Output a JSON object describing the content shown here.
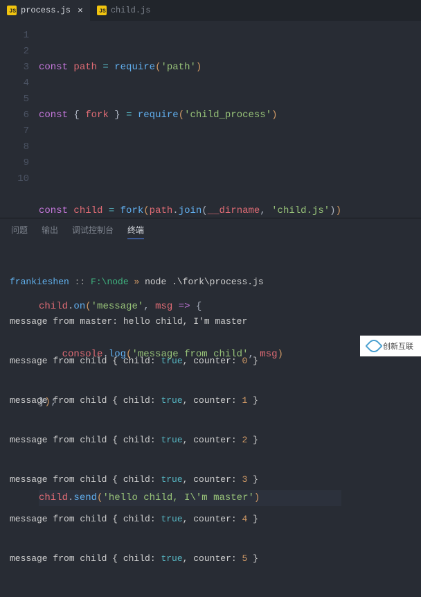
{
  "tabs": [
    {
      "icon": "JS",
      "name": "process.js",
      "active": true,
      "closable": true
    },
    {
      "icon": "JS",
      "name": "child.js",
      "active": false,
      "closable": false
    }
  ],
  "gutter": [
    "1",
    "2",
    "3",
    "4",
    "5",
    "6",
    "7",
    "8",
    "9",
    "10"
  ],
  "code": {
    "l1": {
      "kw": "const",
      "var": "path",
      "eq": " = ",
      "fn": "require",
      "po": "(",
      "str": "'path'",
      "pc": ")"
    },
    "l2": {
      "kw": "const",
      "ob": " { ",
      "var": "fork",
      "cb": " } ",
      "eq": "= ",
      "fn": "require",
      "po": "(",
      "str": "'child_process'",
      "pc": ")"
    },
    "l4": {
      "kw": "const",
      "var": "child",
      "eq": " = ",
      "fn": "fork",
      "po": "(",
      "obj": "path",
      "dot": ".",
      "m": "join",
      "po2": "(",
      "dn": "__dirname",
      "cm": ", ",
      "str": "'child.js'",
      "pc2": ")",
      "pc": ")"
    },
    "l6": {
      "obj": "child",
      "dot": ".",
      "fn": "on",
      "po": "(",
      "str": "'message'",
      "cm": ", ",
      "arg": "msg",
      "arw": " => ",
      "br": "{"
    },
    "l7": {
      "ind": "    ",
      "obj": "console",
      "dot": ".",
      "fn": "log",
      "po": "(",
      "str": "'message from child'",
      "cm": ", ",
      "var": "msg",
      "pc": ")"
    },
    "l8": {
      "br": "}",
      "pc": ")",
      "sc": ";"
    },
    "l10": {
      "obj": "child",
      "dot": ".",
      "fn": "send",
      "po": "(",
      "str": "'hello child, I\\'m master'",
      "pc": ")"
    }
  },
  "panel_tabs": {
    "problems": "问题",
    "output": "输出",
    "debug": "调试控制台",
    "terminal": "终端"
  },
  "terminal": {
    "prompt": {
      "user": "frankieshen",
      "sep": " :: ",
      "path": "F:\\node",
      "arrow": " » ",
      "cmd": "node .\\fork\\process.js"
    },
    "master_line": {
      "pre": "message from master: ",
      "msg": "hello child, I'm master"
    },
    "child_prefix": "message from child { child: ",
    "true_label": "true",
    "counter_label": ", counter: ",
    "counters": [
      "0",
      "1",
      "2",
      "3",
      "4",
      "5"
    ],
    "brace_end": " }"
  },
  "watermark": "创新互联"
}
